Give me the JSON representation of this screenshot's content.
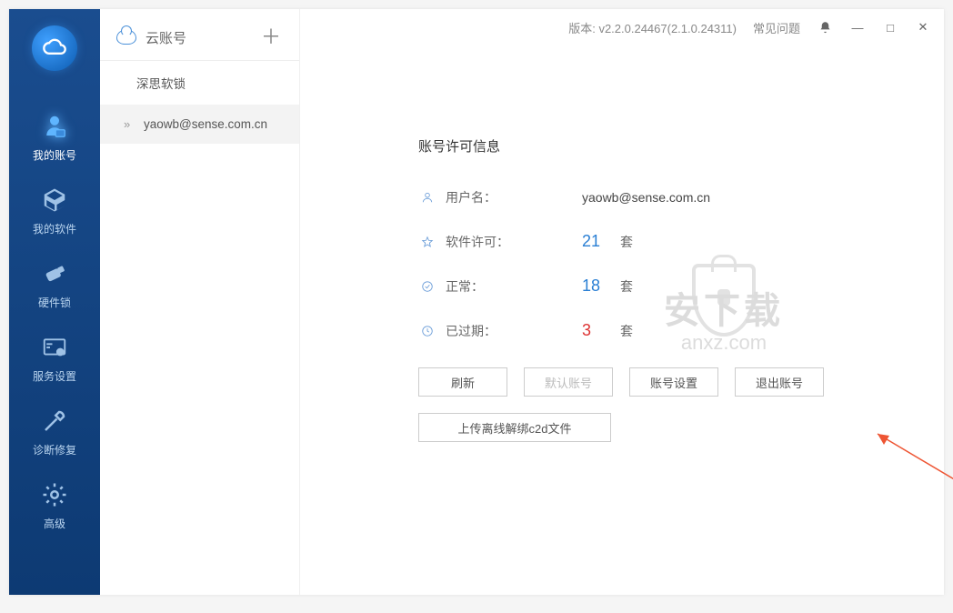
{
  "titlebar": {
    "version_prefix": "版本: ",
    "version": "v2.2.0.24467(2.1.0.24311)",
    "faq": "常见问题"
  },
  "nav": {
    "items": [
      {
        "label": "我的账号",
        "icon": "account"
      },
      {
        "label": "我的软件",
        "icon": "software"
      },
      {
        "label": "硬件锁",
        "icon": "dongle"
      },
      {
        "label": "服务设置",
        "icon": "service"
      },
      {
        "label": "诊断修复",
        "icon": "repair"
      },
      {
        "label": "高级",
        "icon": "advanced"
      }
    ]
  },
  "side": {
    "title": "云账号",
    "items": [
      {
        "label": "深思软锁"
      },
      {
        "label": "yaowb@sense.com.cn"
      }
    ]
  },
  "info": {
    "title": "账号许可信息",
    "username_label": "用户名：",
    "username_value": "yaowb@sense.com.cn",
    "license_label": "软件许可：",
    "license_value": "21",
    "normal_label": "正常：",
    "normal_value": "18",
    "expired_label": "已过期：",
    "expired_value": "3",
    "unit": "套"
  },
  "buttons": {
    "refresh": "刷新",
    "default_account": "默认账号",
    "account_settings": "账号设置",
    "logout": "退出账号",
    "upload_c2d": "上传离线解绑c2d文件"
  },
  "watermark": {
    "big": "安下载",
    "url": "anxz.com"
  }
}
